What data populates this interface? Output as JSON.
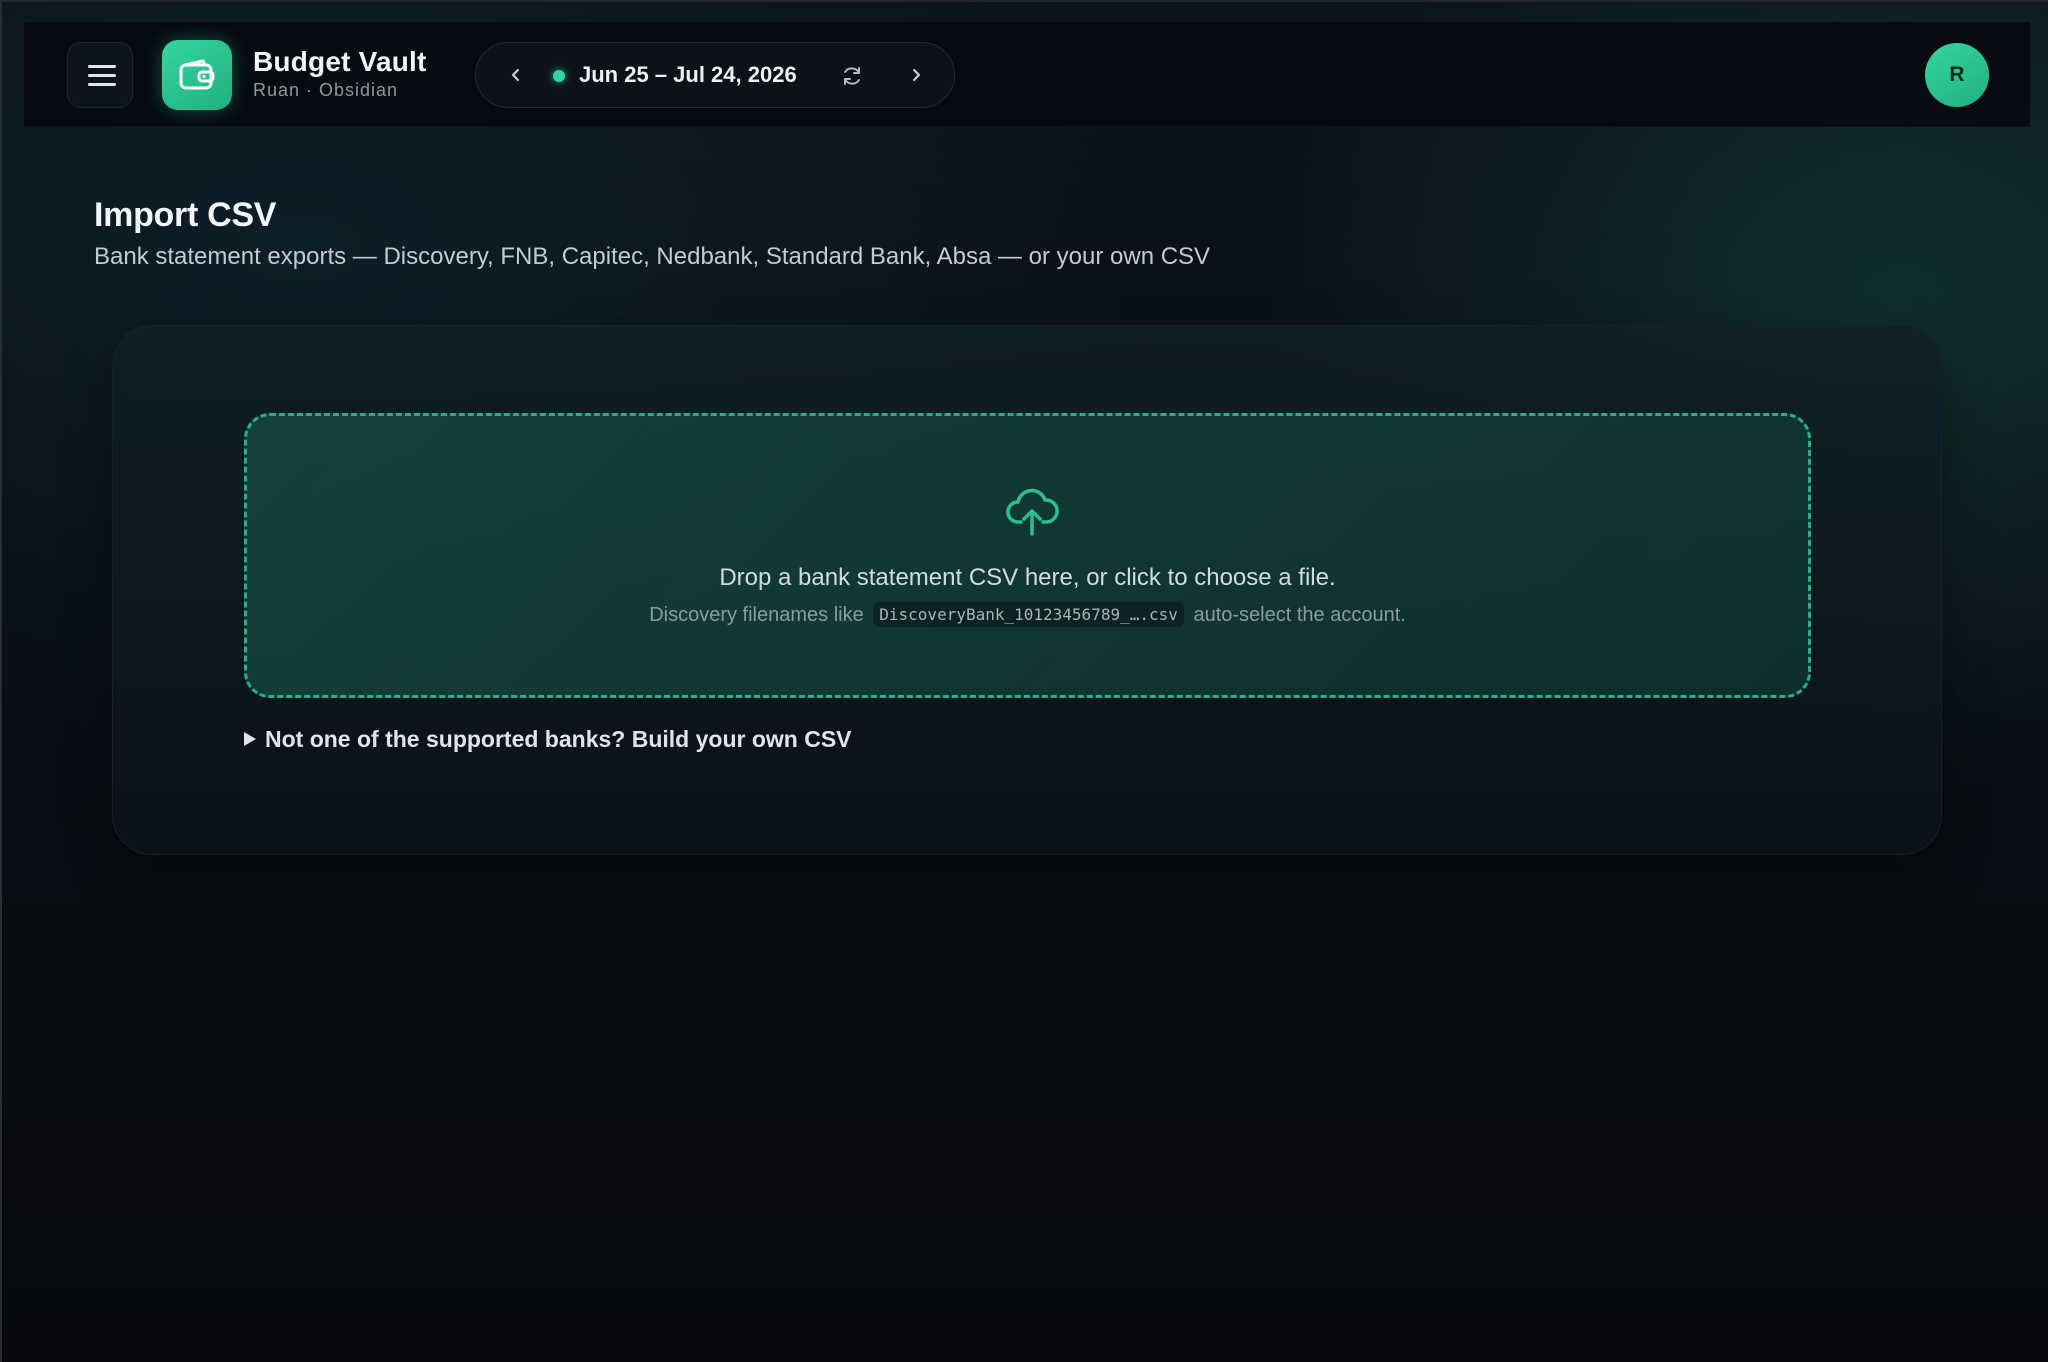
{
  "header": {
    "app_name": "Budget Vault",
    "app_subtitle": "Ruan · Obsidian",
    "date_range": "Jun 25 – Jul 24, 2026",
    "avatar_initial": "R",
    "status_color": "#2ed6a0"
  },
  "icons": {
    "menu": "hamburger-menu-icon",
    "logo": "wallet-icon",
    "prev": "chevron-left-icon",
    "next": "chevron-right-icon",
    "refresh": "refresh-icon",
    "upload": "cloud-upload-icon",
    "expand": "caret-right-icon"
  },
  "page": {
    "title": "Import CSV",
    "subtitle": "Bank statement exports — Discovery, FNB, Capitec, Nedbank, Standard Bank, Absa — or your own CSV"
  },
  "dropzone": {
    "main_text": "Drop a bank statement CSV here, or click to choose a file.",
    "hint_prefix": "Discovery filenames like",
    "hint_code": "DiscoveryBank_10123456789_….csv",
    "hint_suffix": "auto-select the account."
  },
  "custom_csv": {
    "toggle_label": "Not one of the supported banks? Build your own CSV"
  },
  "colors": {
    "accent": "#2ed6a0",
    "accent_dark": "#1fb07f",
    "background": "#090d13"
  }
}
